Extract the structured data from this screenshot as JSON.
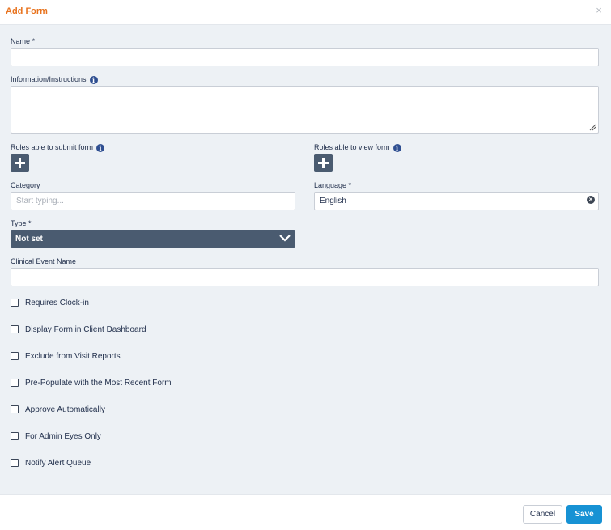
{
  "dialog": {
    "title": "Add Form",
    "close_icon": "×"
  },
  "form": {
    "name": {
      "label": "Name *",
      "value": ""
    },
    "info": {
      "label": "Information/Instructions",
      "value": ""
    },
    "roles_submit": {
      "label": "Roles able to submit form"
    },
    "roles_view": {
      "label": "Roles able to view form"
    },
    "category": {
      "label": "Category",
      "placeholder": "Start typing...",
      "value": ""
    },
    "language": {
      "label": "Language *",
      "value": "English",
      "clear_icon": "×"
    },
    "type": {
      "label": "Type *",
      "value": "Not set"
    },
    "clinical_event": {
      "label": "Clinical Event Name",
      "value": ""
    },
    "checkboxes": [
      {
        "label": "Requires Clock-in",
        "checked": false
      },
      {
        "label": "Display Form in Client Dashboard",
        "checked": false
      },
      {
        "label": "Exclude from Visit Reports",
        "checked": false
      },
      {
        "label": "Pre-Populate with the Most Recent Form",
        "checked": false
      },
      {
        "label": "Approve Automatically",
        "checked": false
      },
      {
        "label": "For Admin Eyes Only",
        "checked": false
      },
      {
        "label": "Notify Alert Queue",
        "checked": false
      }
    ]
  },
  "icons": {
    "info": "i"
  },
  "footer": {
    "cancel_label": "Cancel",
    "save_label": "Save"
  },
  "colors": {
    "title": "#e8731e",
    "primary": "#1792d4",
    "dark_control": "#4a5b70",
    "body_background": "#edf1f5"
  }
}
